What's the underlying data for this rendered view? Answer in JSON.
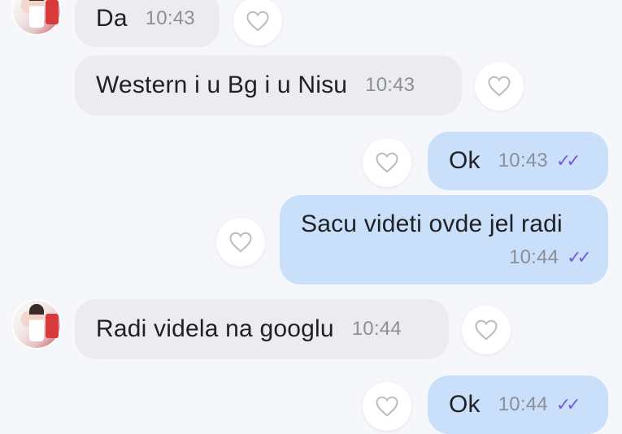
{
  "messages": [
    {
      "text": "Da",
      "time": "10:43"
    },
    {
      "text": "Western i u Bg i u Nisu",
      "time": "10:43"
    },
    {
      "text": "Ok",
      "time": "10:43",
      "read": "✓✓"
    },
    {
      "text": "Sacu videti ovde jel radi",
      "time": "10:44",
      "read": "✓✓"
    },
    {
      "text": "Radi videla na googlu",
      "time": "10:44"
    },
    {
      "text": "Ok",
      "time": "10:44",
      "read": "✓✓"
    }
  ],
  "icons": {
    "like": "heart-outline-icon",
    "read_receipt": "double-check-icon"
  },
  "colors": {
    "incoming_bubble": "#ececee",
    "outgoing_bubble": "#c9dffa",
    "read_receipt": "#7b5bd8",
    "background": "#f6f7fb"
  }
}
